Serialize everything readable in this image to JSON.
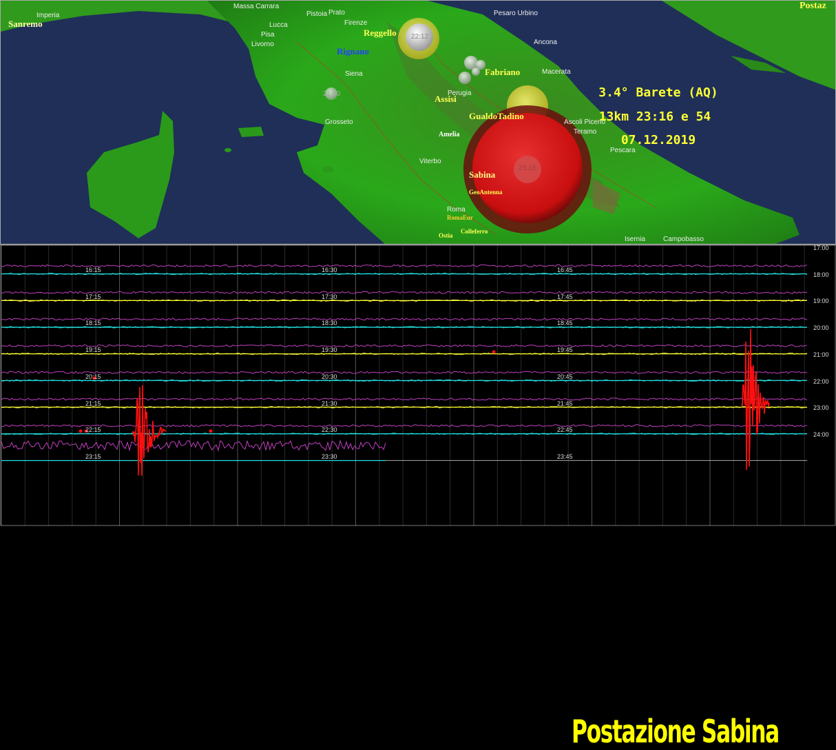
{
  "map": {
    "cities": [
      {
        "name": "Massa Carrara"
      },
      {
        "name": "Lucca"
      },
      {
        "name": "Pisa"
      },
      {
        "name": "Livorno"
      },
      {
        "name": "Pistoia"
      },
      {
        "name": "Prato"
      },
      {
        "name": "Firenze"
      },
      {
        "name": "Siena"
      },
      {
        "name": "Grosseto"
      },
      {
        "name": "Perugia"
      },
      {
        "name": "Pesaro Urbino"
      },
      {
        "name": "Ancona"
      },
      {
        "name": "Macerata"
      },
      {
        "name": "Viterbo"
      },
      {
        "name": "Roma"
      },
      {
        "name": "Imperia"
      },
      {
        "name": "Isernia"
      },
      {
        "name": "Campobasso"
      },
      {
        "name": "Pescara"
      },
      {
        "name": "Ascoli Piceno"
      },
      {
        "name": "Teramo"
      }
    ],
    "stations": [
      {
        "name": "Sanremo",
        "color": "#ffffaa"
      },
      {
        "name": "Reggello",
        "color": "#ffff55"
      },
      {
        "name": "Rignano",
        "color": "#2244ff"
      },
      {
        "name": "Fabriano",
        "color": "#ffff55"
      },
      {
        "name": "Assisi",
        "color": "#ffff55"
      },
      {
        "name": "GualdoTadino",
        "color": "#ffff55"
      },
      {
        "name": "Amelia",
        "color": "#ffffff"
      },
      {
        "name": "Sabina",
        "color": "#ffff88"
      },
      {
        "name": "GeoAntenna",
        "color": "#ffff55"
      },
      {
        "name": "RomaEur",
        "color": "#ffcc33"
      },
      {
        "name": "Colleferro",
        "color": "#ffff55"
      },
      {
        "name": "Ostia",
        "color": "#ffff55"
      },
      {
        "name": "Postaz",
        "color": "#ffff55"
      }
    ],
    "quake_labels": [
      "22:12",
      "23:16",
      "21:50"
    ],
    "info": {
      "line1": "3.4° Barete (AQ)",
      "line2": "13km 23:16 e 54",
      "line3": "07.12.2019"
    }
  },
  "seismogram": {
    "row_labels": [
      {
        "q1": "16:15",
        "q2": "16:30",
        "q3": "16:45",
        "hour": "17:00"
      },
      {
        "q1": "17:15",
        "q2": "17:30",
        "q3": "17:45",
        "hour": "18:00"
      },
      {
        "q1": "18:15",
        "q2": "18:30",
        "q3": "18:45",
        "hour": "19:00"
      },
      {
        "q1": "19:15",
        "q2": "19:30",
        "q3": "19:45",
        "hour": "20:00"
      },
      {
        "q1": "20:15",
        "q2": "20:30",
        "q3": "20:45",
        "hour": "21:00"
      },
      {
        "q1": "21:15",
        "q2": "21:30",
        "q3": "21:45",
        "hour": "22:00"
      },
      {
        "q1": "22:15",
        "q2": "22:30",
        "q3": "22:45",
        "hour": "23:00"
      },
      {
        "q1": "23:15",
        "q2": "23:30",
        "q3": "23:45",
        "hour": "24:00"
      }
    ],
    "colors": {
      "hour_line": "#ffff33",
      "trace_cyan": "#22e0e0",
      "trace_magenta": "#c040c0",
      "event": "#ff1010"
    },
    "banner": "Postazione Sabina"
  }
}
